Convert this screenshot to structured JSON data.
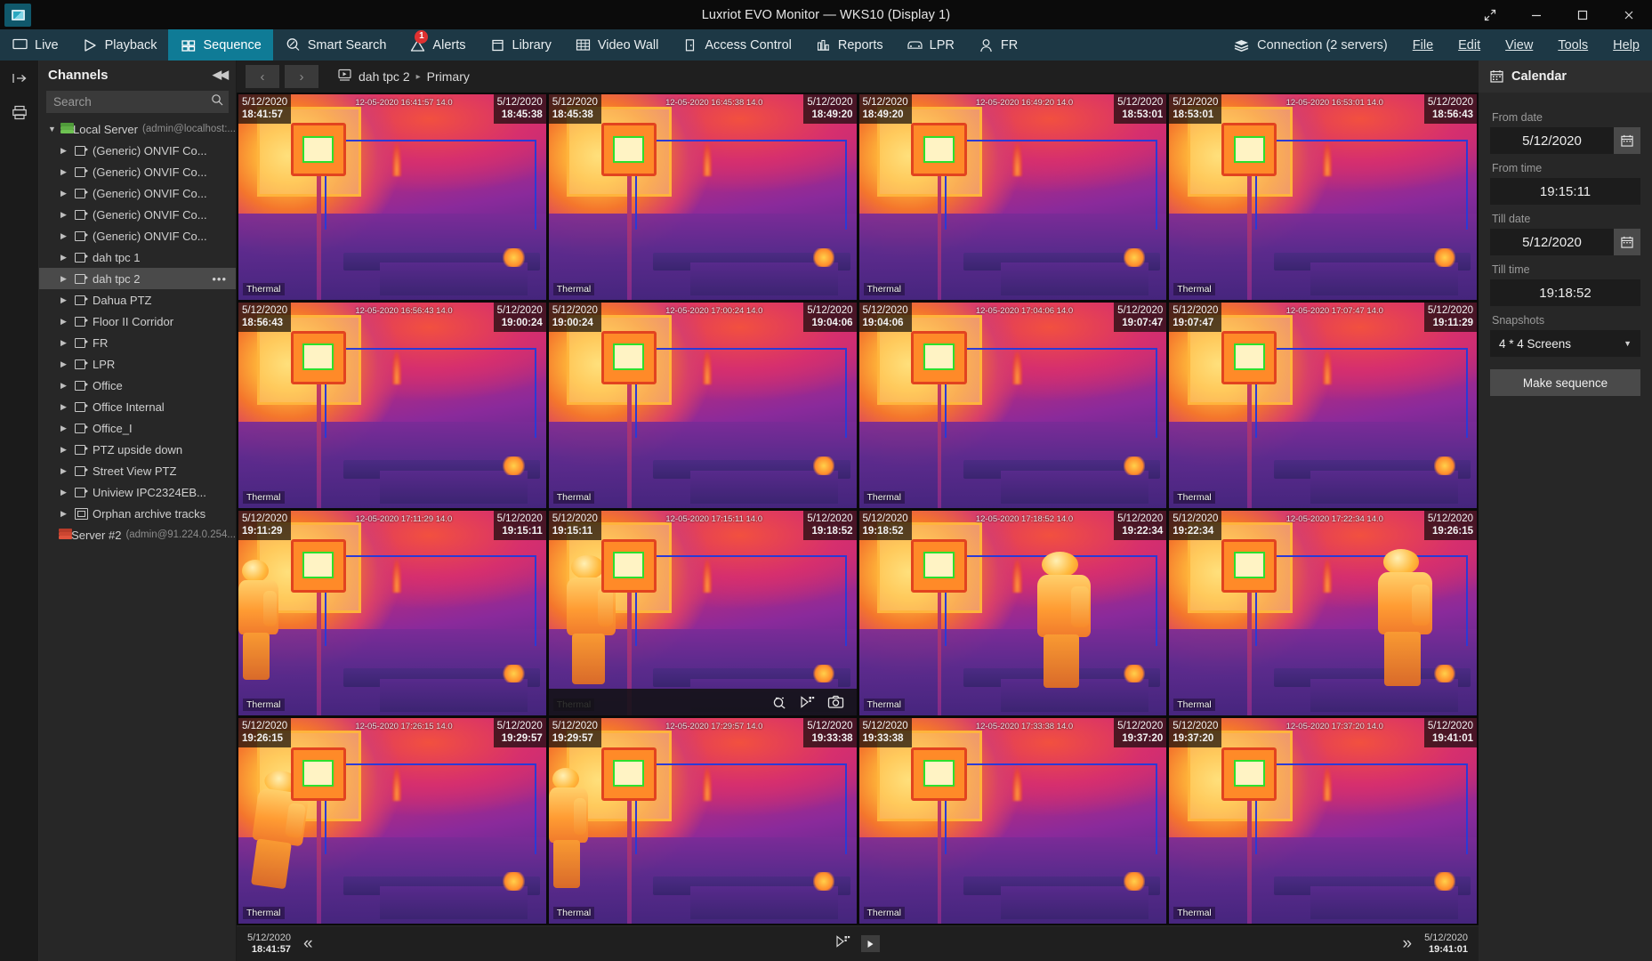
{
  "window": {
    "title": "Luxriot EVO Monitor — WKS10 (Display 1)",
    "logo_icon": "app-monitor-icon",
    "controls": {
      "expand": "expand-icon",
      "minimize": "minimize-icon",
      "maximize": "maximize-icon",
      "close": "close-icon"
    }
  },
  "toolbar": {
    "items": [
      {
        "label": "Live",
        "icon": "monitor-icon",
        "active": false,
        "badge": null
      },
      {
        "label": "Playback",
        "icon": "play-triangle-icon",
        "active": false,
        "badge": null
      },
      {
        "label": "Sequence",
        "icon": "grid-sequence-icon",
        "active": true,
        "badge": null
      },
      {
        "label": "Smart Search",
        "icon": "magnifier-motion-icon",
        "active": false,
        "badge": null
      },
      {
        "label": "Alerts",
        "icon": "warning-triangle-icon",
        "active": false,
        "badge": "1"
      },
      {
        "label": "Library",
        "icon": "library-box-icon",
        "active": false,
        "badge": null
      },
      {
        "label": "Video Wall",
        "icon": "video-wall-icon",
        "active": false,
        "badge": null
      },
      {
        "label": "Access Control",
        "icon": "door-icon",
        "active": false,
        "badge": null
      },
      {
        "label": "Reports",
        "icon": "bar-chart-icon",
        "active": false,
        "badge": null
      },
      {
        "label": "LPR",
        "icon": "car-icon",
        "active": false,
        "badge": null
      },
      {
        "label": "FR",
        "icon": "person-icon",
        "active": false,
        "badge": null
      }
    ],
    "connection": {
      "label": "Connection (2 servers)",
      "icon": "servers-stack-icon"
    },
    "menus": [
      "File",
      "Edit",
      "View",
      "Tools",
      "Help"
    ]
  },
  "rail": {
    "buttons": [
      {
        "icon": "expand-panel-icon"
      },
      {
        "icon": "print-layout-icon"
      }
    ]
  },
  "channels": {
    "title": "Channels",
    "collapse_icon": "collapse-left-icon",
    "search": {
      "placeholder": "Search",
      "value": "",
      "icon": "search-icon"
    },
    "tree": [
      {
        "level": 0,
        "label": "Local Server",
        "sub": "(admin@localhost:...",
        "icon": "server-green-icon",
        "arrow": "down",
        "selected": false
      },
      {
        "level": 1,
        "label": "(Generic) ONVIF Co...",
        "icon": "camera-icon",
        "arrow": "right",
        "selected": false
      },
      {
        "level": 1,
        "label": "(Generic) ONVIF Co...",
        "icon": "camera-icon",
        "arrow": "right",
        "selected": false
      },
      {
        "level": 1,
        "label": "(Generic) ONVIF Co...",
        "icon": "camera-icon",
        "arrow": "right",
        "selected": false
      },
      {
        "level": 1,
        "label": "(Generic) ONVIF Co...",
        "icon": "camera-icon",
        "arrow": "right",
        "selected": false
      },
      {
        "level": 1,
        "label": "(Generic) ONVIF Co...",
        "icon": "camera-icon",
        "arrow": "right",
        "selected": false
      },
      {
        "level": 1,
        "label": "dah tpc 1",
        "icon": "camera-icon",
        "arrow": "right",
        "selected": false
      },
      {
        "level": 1,
        "label": "dah tpc 2",
        "icon": "camera-icon",
        "arrow": "right",
        "selected": true,
        "menu": "•••"
      },
      {
        "level": 1,
        "label": "Dahua PTZ",
        "icon": "camera-icon",
        "arrow": "right",
        "selected": false
      },
      {
        "level": 1,
        "label": "Floor II Corridor",
        "icon": "camera-icon",
        "arrow": "right",
        "selected": false
      },
      {
        "level": 1,
        "label": "FR",
        "icon": "camera-icon",
        "arrow": "right",
        "selected": false
      },
      {
        "level": 1,
        "label": "LPR",
        "icon": "camera-icon",
        "arrow": "right",
        "selected": false
      },
      {
        "level": 1,
        "label": "Office",
        "icon": "camera-icon",
        "arrow": "right",
        "selected": false
      },
      {
        "level": 1,
        "label": "Office Internal",
        "icon": "camera-icon",
        "arrow": "right",
        "selected": false
      },
      {
        "level": 1,
        "label": "Office_I",
        "icon": "camera-icon",
        "arrow": "right",
        "selected": false
      },
      {
        "level": 1,
        "label": "PTZ upside down",
        "icon": "camera-icon",
        "arrow": "right",
        "selected": false
      },
      {
        "level": 1,
        "label": "Street View PTZ",
        "icon": "camera-icon",
        "arrow": "right",
        "selected": false
      },
      {
        "level": 1,
        "label": "Uniview IPC2324EB...",
        "icon": "camera-icon",
        "arrow": "right",
        "selected": false
      },
      {
        "level": 1,
        "label": "Orphan archive tracks",
        "icon": "folder-archive-icon",
        "arrow": "right",
        "selected": false
      },
      {
        "level": 0,
        "label": "Server #2",
        "sub": "(admin@91.224.0.254...",
        "icon": "server-red-icon",
        "arrow": "none",
        "selected": false
      }
    ]
  },
  "breadcrumb": {
    "back_icon": "chevron-left-icon",
    "forward_icon": "chevron-right-icon",
    "channel_icon": "stream-icon",
    "channel": "dah tpc 2",
    "separator": "▸",
    "stream": "Primary"
  },
  "grid": {
    "layout": "4x4",
    "selected_index": 9,
    "camera_watermark_prefix": "12-05-2020",
    "thermal_label": "Thermal",
    "tiles": [
      {
        "start_date": "5/12/2020",
        "start_time": "18:41:57",
        "end_date": "5/12/2020",
        "end_time": "18:45:38",
        "watermark": "12-05-2020 16:41:57 14.0",
        "person": "none"
      },
      {
        "start_date": "5/12/2020",
        "start_time": "18:45:38",
        "end_date": "5/12/2020",
        "end_time": "18:49:20",
        "watermark": "12-05-2020 16:45:38 14.0",
        "person": "none"
      },
      {
        "start_date": "5/12/2020",
        "start_time": "18:49:20",
        "end_date": "5/12/2020",
        "end_time": "18:53:01",
        "watermark": "12-05-2020 16:49:20 14.0",
        "person": "none"
      },
      {
        "start_date": "5/12/2020",
        "start_time": "18:53:01",
        "end_date": "5/12/2020",
        "end_time": "18:56:43",
        "watermark": "12-05-2020 16:53:01 14.0",
        "person": "none"
      },
      {
        "start_date": "5/12/2020",
        "start_time": "18:56:43",
        "end_date": "5/12/2020",
        "end_time": "19:00:24",
        "watermark": "12-05-2020 16:56:43 14.0",
        "person": "none"
      },
      {
        "start_date": "5/12/2020",
        "start_time": "19:00:24",
        "end_date": "5/12/2020",
        "end_time": "19:04:06",
        "watermark": "12-05-2020 17:00:24 14.0",
        "person": "none"
      },
      {
        "start_date": "5/12/2020",
        "start_time": "19:04:06",
        "end_date": "5/12/2020",
        "end_time": "19:07:47",
        "watermark": "12-05-2020 17:04:06 14.0",
        "person": "none"
      },
      {
        "start_date": "5/12/2020",
        "start_time": "19:07:47",
        "end_date": "5/12/2020",
        "end_time": "19:11:29",
        "watermark": "12-05-2020 17:07:47 14.0",
        "person": "none"
      },
      {
        "start_date": "5/12/2020",
        "start_time": "19:11:29",
        "end_date": "5/12/2020",
        "end_time": "19:15:11",
        "watermark": "12-05-2020 17:11:29 14.0",
        "person": "left-partial"
      },
      {
        "start_date": "5/12/2020",
        "start_time": "19:15:11",
        "end_date": "5/12/2020",
        "end_time": "19:18:52",
        "watermark": "12-05-2020 17:15:11 14.0",
        "person": "standing-left"
      },
      {
        "start_date": "5/12/2020",
        "start_time": "19:18:52",
        "end_date": "5/12/2020",
        "end_time": "19:22:34",
        "watermark": "12-05-2020 17:18:52 14.0",
        "person": "standing-right"
      },
      {
        "start_date": "5/12/2020",
        "start_time": "19:22:34",
        "end_date": "5/12/2020",
        "end_time": "19:26:15",
        "watermark": "12-05-2020 17:22:34 14.0",
        "person": "standing-far-right"
      },
      {
        "start_date": "5/12/2020",
        "start_time": "19:26:15",
        "end_date": "5/12/2020",
        "end_time": "19:29:57",
        "watermark": "12-05-2020 17:26:15 14.0",
        "person": "bending"
      },
      {
        "start_date": "5/12/2020",
        "start_time": "19:29:57",
        "end_date": "5/12/2020",
        "end_time": "19:33:38",
        "watermark": "12-05-2020 17:29:57 14.0",
        "person": "left-partial"
      },
      {
        "start_date": "5/12/2020",
        "start_time": "19:33:38",
        "end_date": "5/12/2020",
        "end_time": "19:37:20",
        "watermark": "12-05-2020 17:33:38 14.0",
        "person": "none"
      },
      {
        "start_date": "5/12/2020",
        "start_time": "19:37:20",
        "end_date": "5/12/2020",
        "end_time": "19:41:01",
        "watermark": "12-05-2020 17:37:20 14.0",
        "person": "none"
      }
    ],
    "tile_toolbar": {
      "icons": [
        "zoom-region-icon",
        "export-frame-icon",
        "snapshot-camera-icon"
      ]
    }
  },
  "timeline": {
    "start_date": "5/12/2020",
    "start_time": "18:41:57",
    "end_date": "5/12/2020",
    "end_time": "19:41:01",
    "prev_icon": "double-chevron-left-icon",
    "next_icon": "double-chevron-right-icon",
    "export_icon": "export-sequence-icon",
    "play_icon": "play-button-icon"
  },
  "calendar": {
    "title": "Calendar",
    "title_icon": "calendar-icon",
    "fields": [
      {
        "label": "From date",
        "value": "5/12/2020",
        "picker": true,
        "name": "from-date"
      },
      {
        "label": "From time",
        "value": "19:15:11",
        "picker": false,
        "name": "from-time"
      },
      {
        "label": "Till date",
        "value": "5/12/2020",
        "picker": true,
        "name": "till-date"
      },
      {
        "label": "Till time",
        "value": "19:18:52",
        "picker": false,
        "name": "till-time"
      }
    ],
    "snapshots_label": "Snapshots",
    "snapshots_value": "4 * 4 Screens",
    "make_sequence_label": "Make sequence"
  },
  "colors": {
    "accent": "#0f7b96",
    "toolbar_bg": "#1d3845",
    "selection": "#e5e52a",
    "alert": "#e03131"
  }
}
